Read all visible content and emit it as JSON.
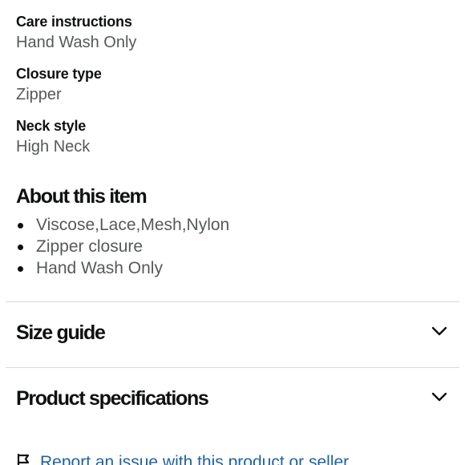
{
  "attributes": [
    {
      "label": "Care instructions",
      "value": "Hand Wash Only"
    },
    {
      "label": "Closure type",
      "value": "Zipper"
    },
    {
      "label": "Neck style",
      "value": "High Neck"
    }
  ],
  "about": {
    "title": "About this item",
    "bullets": [
      "Viscose,Lace,Mesh,Nylon",
      "Zipper closure",
      "Hand Wash Only"
    ]
  },
  "size_guide": {
    "label": "Size guide",
    "icon": "chevron-down-icon"
  },
  "product_specs": {
    "label": "Product specifications",
    "icon": "chevron-down-icon"
  },
  "report": {
    "label": "Report an issue with this product or seller",
    "icon": "flag-icon"
  },
  "colors": {
    "text": "#0f1111",
    "muted": "#565959",
    "link": "#2162a1",
    "divider": "#d5d9d9"
  }
}
